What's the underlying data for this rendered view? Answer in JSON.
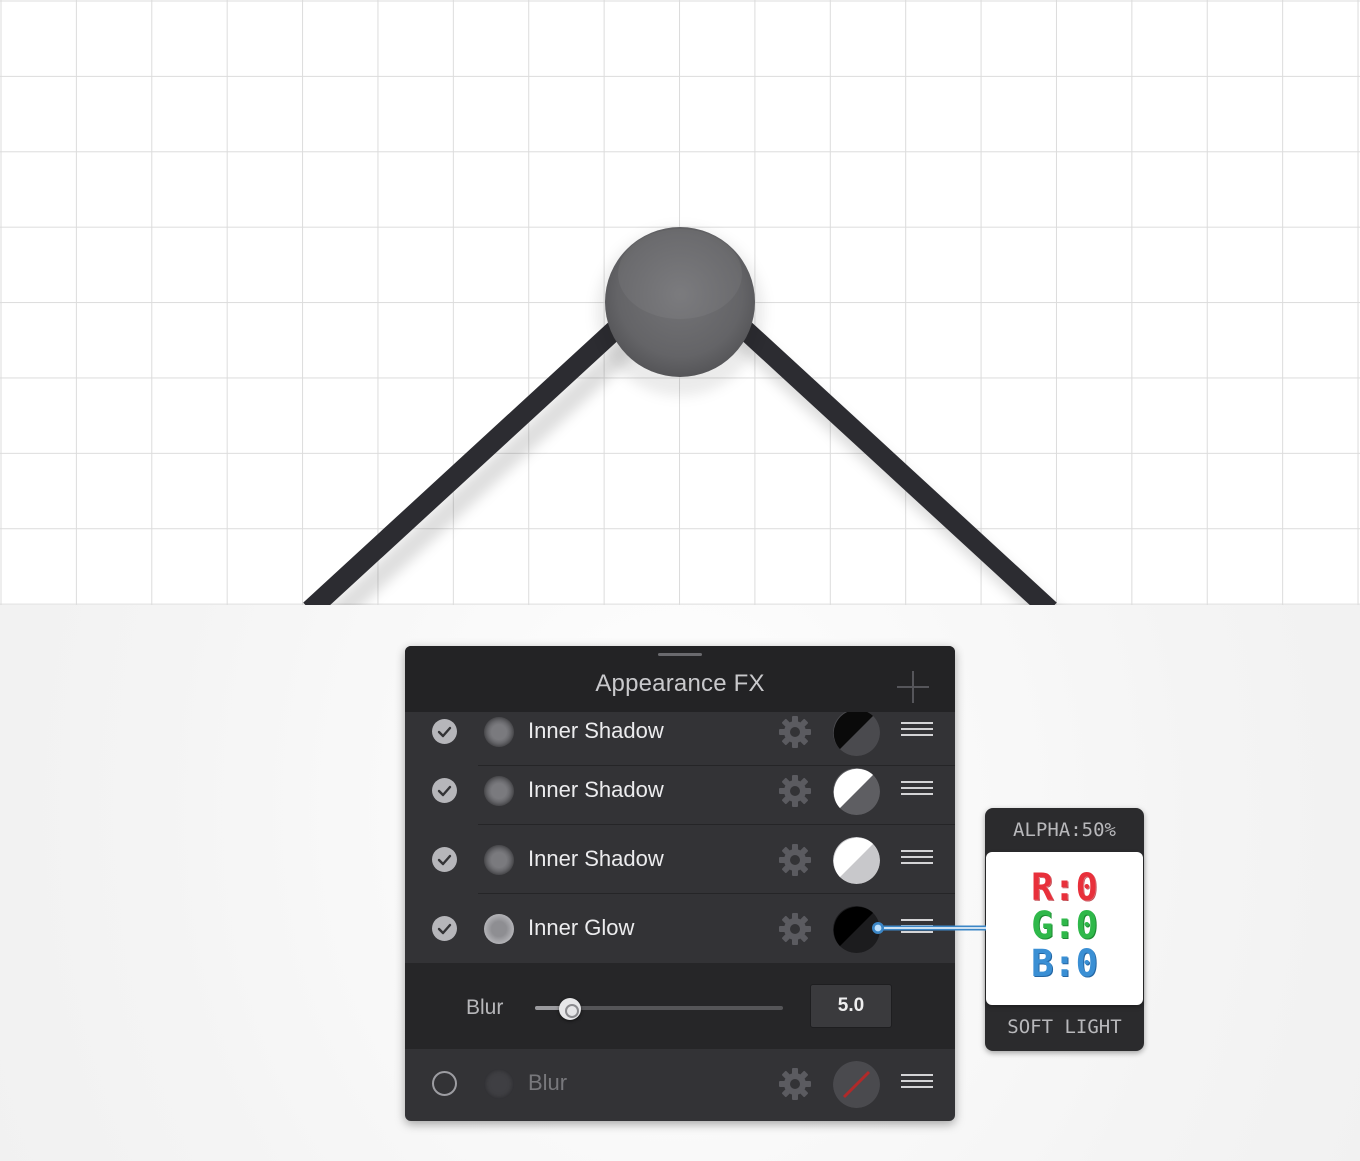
{
  "panel": {
    "title": "Appearance FX"
  },
  "effects": [
    {
      "label": "Inner Shadow",
      "enabled": true,
      "swatch": "black-gray"
    },
    {
      "label": "Inner Shadow",
      "enabled": true,
      "swatch": "white-gray"
    },
    {
      "label": "Inner Shadow",
      "enabled": true,
      "swatch": "white-lightgray"
    },
    {
      "label": "Inner Glow",
      "enabled": true,
      "swatch": "black-dark"
    },
    {
      "label": "Blur",
      "enabled": false,
      "swatch": "none"
    }
  ],
  "blur_control": {
    "label": "Blur",
    "value": "5.0",
    "slider_fraction": 0.14
  },
  "color_tooltip": {
    "alpha": "ALPHA:50%",
    "r": "R:0",
    "g": "G:0",
    "b": "B:0",
    "blend_mode": "SOFT LIGHT"
  },
  "colors": {
    "panel_bg": "#333336",
    "header_bg": "#232325",
    "line_stroke": "#2b2b30",
    "node_fill": "#6b6b6e"
  }
}
